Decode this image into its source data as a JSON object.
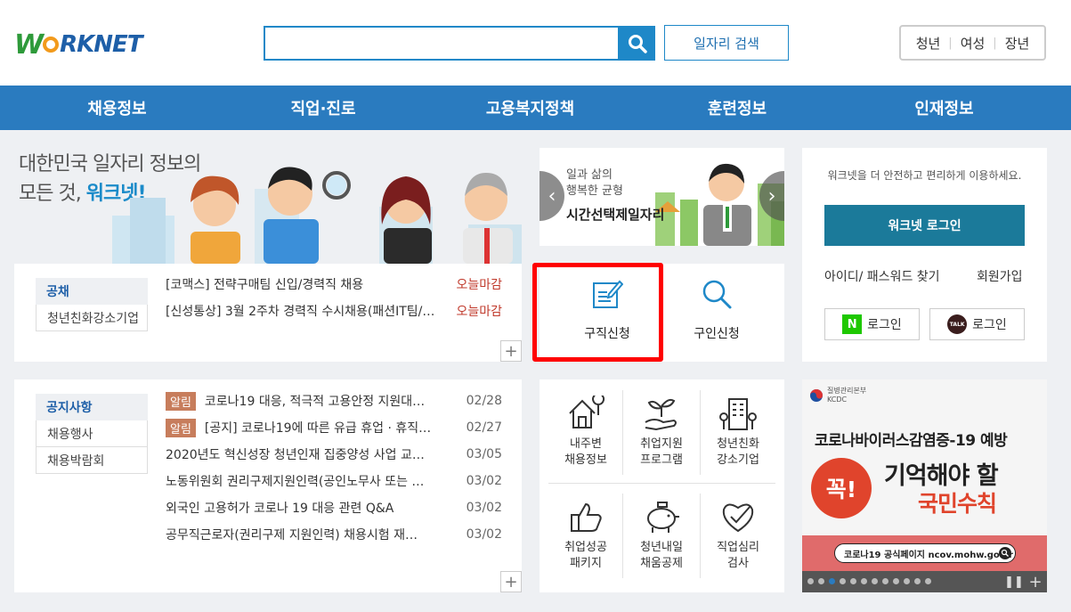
{
  "header": {
    "logo_text": "WORKNET",
    "search": {
      "value": "",
      "placeholder": ""
    },
    "job_search_label": "일자리 검색",
    "audience": [
      "청년",
      "여성",
      "장년"
    ]
  },
  "gnb": [
    "채용정보",
    "직업·진로",
    "고용복지정책",
    "훈련정보",
    "인재정보"
  ],
  "hero": {
    "line1": "대한민국 일자리 정보의",
    "line2_prefix": "모든 것,",
    "line2_brand": "워크넷!"
  },
  "recruit": {
    "tabs": [
      "공채",
      "청년친화강소기업"
    ],
    "rows": [
      {
        "title": "[코맥스]  전략구매팀 신입/경력직 채용",
        "deadline": "오늘마감"
      },
      {
        "title": "[신성통상]  3월 2주차 경력직 수시채용(패션IT팀/…",
        "deadline": "오늘마감"
      }
    ]
  },
  "center_banner": {
    "line1": "일과 삶의",
    "line2": "행복한 균형",
    "line3": "시간선택제일자리"
  },
  "apply": {
    "seeker": "구직신청",
    "employer": "구인신청"
  },
  "login": {
    "msg": "워크넷을 더 안전하고 편리하게 이용하세요.",
    "login_btn": "워크넷 로그인",
    "find": "아이디/ 패스워드 찾기",
    "join": "회원가입",
    "naver": "로그인",
    "kakao": "로그인",
    "naver_icon": "N",
    "kakao_icon": "TALK"
  },
  "notice": {
    "tabs": [
      "공지사항",
      "채용행사",
      "채용박람회"
    ],
    "badge": "알림",
    "rows": [
      {
        "badge": true,
        "title": "코로나19 대응, 적극적 고용안정 지원대…",
        "date": "02/28"
      },
      {
        "badge": true,
        "title": "[공지] 코로나19에 따른 유급 휴업 · 휴직…",
        "date": "02/27"
      },
      {
        "badge": false,
        "title": "2020년도 혁신성장 청년인재 집중양성 사업 교…",
        "date": "03/05"
      },
      {
        "badge": false,
        "title": "노동위원회 권리구제지원인력(공인노무사 또는 …",
        "date": "03/02"
      },
      {
        "badge": false,
        "title": "외국인 고용허가 코로나 19 대응 관련 Q&A",
        "date": "03/02"
      },
      {
        "badge": false,
        "title": "공무직근로자(권리구제 지원인력) 채용시험 재…",
        "date": "03/02"
      }
    ]
  },
  "quick": [
    {
      "l1": "내주변",
      "l2": "채용정보"
    },
    {
      "l1": "취업지원",
      "l2": "프로그램"
    },
    {
      "l1": "청년친화",
      "l2": "강소기업"
    },
    {
      "l1": "취업성공",
      "l2": "패키지"
    },
    {
      "l1": "청년내일",
      "l2": "채움공제"
    },
    {
      "l1": "직업심리",
      "l2": "검사"
    }
  ],
  "covid": {
    "agency": "질병관리본부",
    "agency_en": "KCDC",
    "title": "코로나바이러스감염증-19 예방",
    "stamp": "꼭!",
    "big1": "기억해야 할",
    "big2": "국민수칙",
    "url": "코로나19 공식페이지 ncov.mohw.go.kr",
    "active_dot": 3
  },
  "colors": {
    "brand_blue": "#2a7bbf",
    "highlight_red": "#ff0000",
    "deadline_red": "#c0392b"
  }
}
